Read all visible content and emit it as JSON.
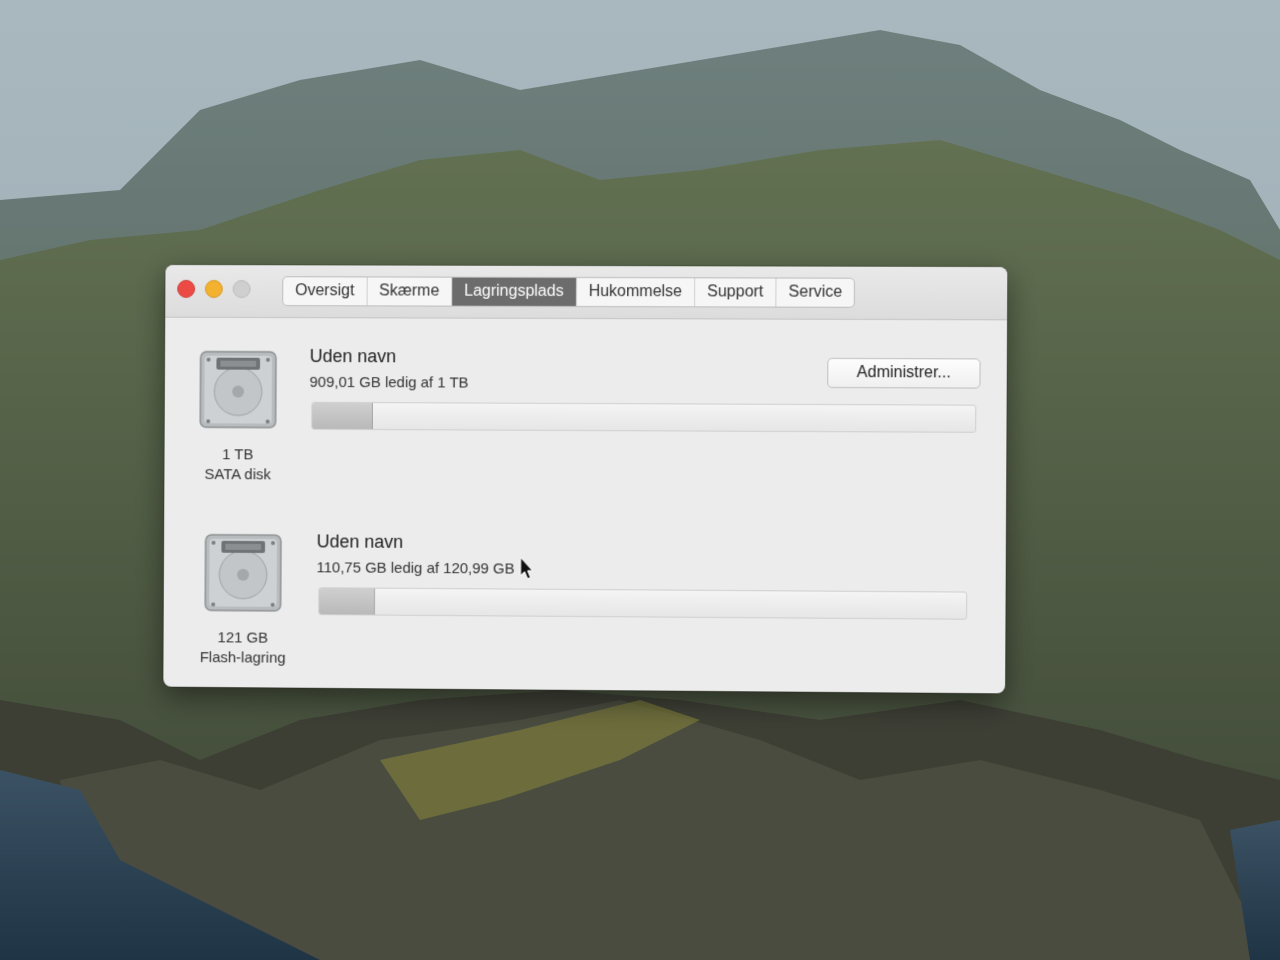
{
  "window": {
    "tabs": [
      {
        "label": "Oversigt"
      },
      {
        "label": "Skærme"
      },
      {
        "label": "Lagringsplads"
      },
      {
        "label": "Hukommelse"
      },
      {
        "label": "Support"
      },
      {
        "label": "Service"
      }
    ],
    "active_tab": "Lagringsplads"
  },
  "disks": [
    {
      "icon": "hard-drive-icon",
      "capacity": "1 TB",
      "type": "SATA disk",
      "volume_name": "Uden navn",
      "free_info": "909,01 GB ledig af 1 TB",
      "used_fraction": 0.091
    },
    {
      "icon": "hard-drive-icon",
      "capacity": "121 GB",
      "type": "Flash-lagring",
      "volume_name": "Uden navn",
      "free_info": "110,75 GB ledig af 120,99 GB",
      "used_fraction": 0.085
    }
  ],
  "manage_button": {
    "label": "Administrer..."
  },
  "colors": {
    "close": "#ec4b45",
    "minimize": "#f2b12f",
    "active_tab": "#6c6c6c"
  }
}
